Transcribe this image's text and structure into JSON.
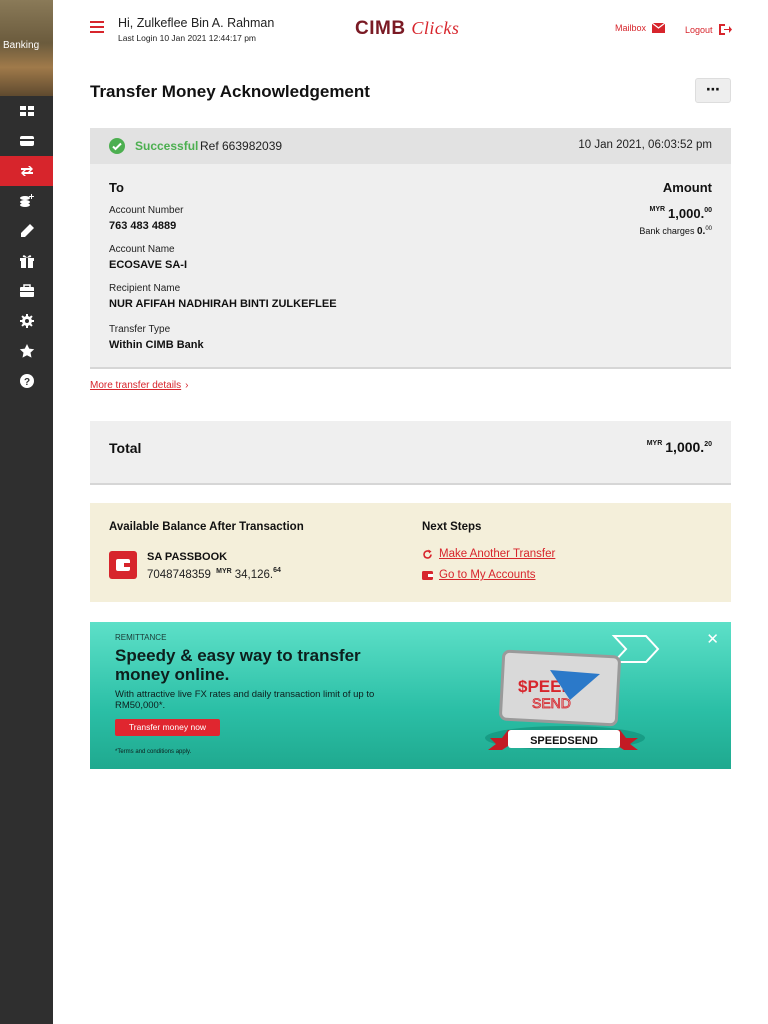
{
  "sidebar": {
    "banner_label": "Banking",
    "items": [
      {
        "name": "dashboard-icon"
      },
      {
        "name": "card-icon"
      },
      {
        "name": "transfer-icon",
        "active": true
      },
      {
        "name": "pay-bills-icon"
      },
      {
        "name": "pen-icon"
      },
      {
        "name": "gift-icon"
      },
      {
        "name": "briefcase-icon"
      },
      {
        "name": "gear-icon"
      },
      {
        "name": "star-icon"
      },
      {
        "name": "help-icon"
      }
    ]
  },
  "header": {
    "greeting": "Hi, Zulkeflee Bin A. Rahman",
    "last_login": "Last Login 10 Jan 2021 12:44:17 pm",
    "brand_main": "CIMB",
    "brand_script": "Clicks",
    "mailbox_label": "Mailbox",
    "logout_label": "Logout"
  },
  "page": {
    "title": "Transfer Money Acknowledgement",
    "more_button": "⋯"
  },
  "result": {
    "status": "Successful",
    "ref": "Ref 663982039",
    "timestamp": "10 Jan 2021, 06:03:52 pm",
    "to_label": "To",
    "amount_label": "Amount",
    "fields": [
      {
        "label": "Account Number",
        "value": "763 483 4889"
      },
      {
        "label": "Account Name",
        "value": "ECOSAVE SA-I"
      },
      {
        "label": "Recipient Name",
        "value": "NUR AFIFAH NADHIRAH BINTI ZULKEFLEE"
      },
      {
        "label": "Transfer Type",
        "value": "Within CIMB Bank"
      }
    ],
    "amount_currency": "MYR",
    "amount_main": "1,000.",
    "amount_cents": "00",
    "charges_label": "Bank charges",
    "charges_main": "0.",
    "charges_cents": "00"
  },
  "more_details_link": "More transfer details",
  "total": {
    "label": "Total",
    "currency": "MYR",
    "main": "1,000.",
    "cents": "20"
  },
  "balance": {
    "title": "Available Balance After Transaction",
    "account_name": "SA PASSBOOK",
    "account_number": "7048748359",
    "currency": "MYR",
    "main": "34,126.",
    "cents": "64"
  },
  "next_steps": {
    "title": "Next Steps",
    "items": [
      {
        "label": "Make Another Transfer",
        "icon": "refresh-icon"
      },
      {
        "label": "Go to My Accounts",
        "icon": "wallet-icon"
      }
    ]
  },
  "promo": {
    "tag": "REMITTANCE",
    "headline": "Speedy & easy way to transfer money online.",
    "sub": "With attractive live FX rates and daily transaction limit of up to RM50,000*.",
    "button": "Transfer money now",
    "terms": "*Terms and conditions apply.",
    "logo_line1": "$PEED",
    "logo_line2": "SEND",
    "ribbon": "SPEEDSEND"
  },
  "colors": {
    "accent": "#d7252c",
    "success": "#4caf50",
    "sidebar": "#2f2f2f",
    "balance_bg": "#f4efda",
    "promo_bg": "#2bbfa6"
  }
}
